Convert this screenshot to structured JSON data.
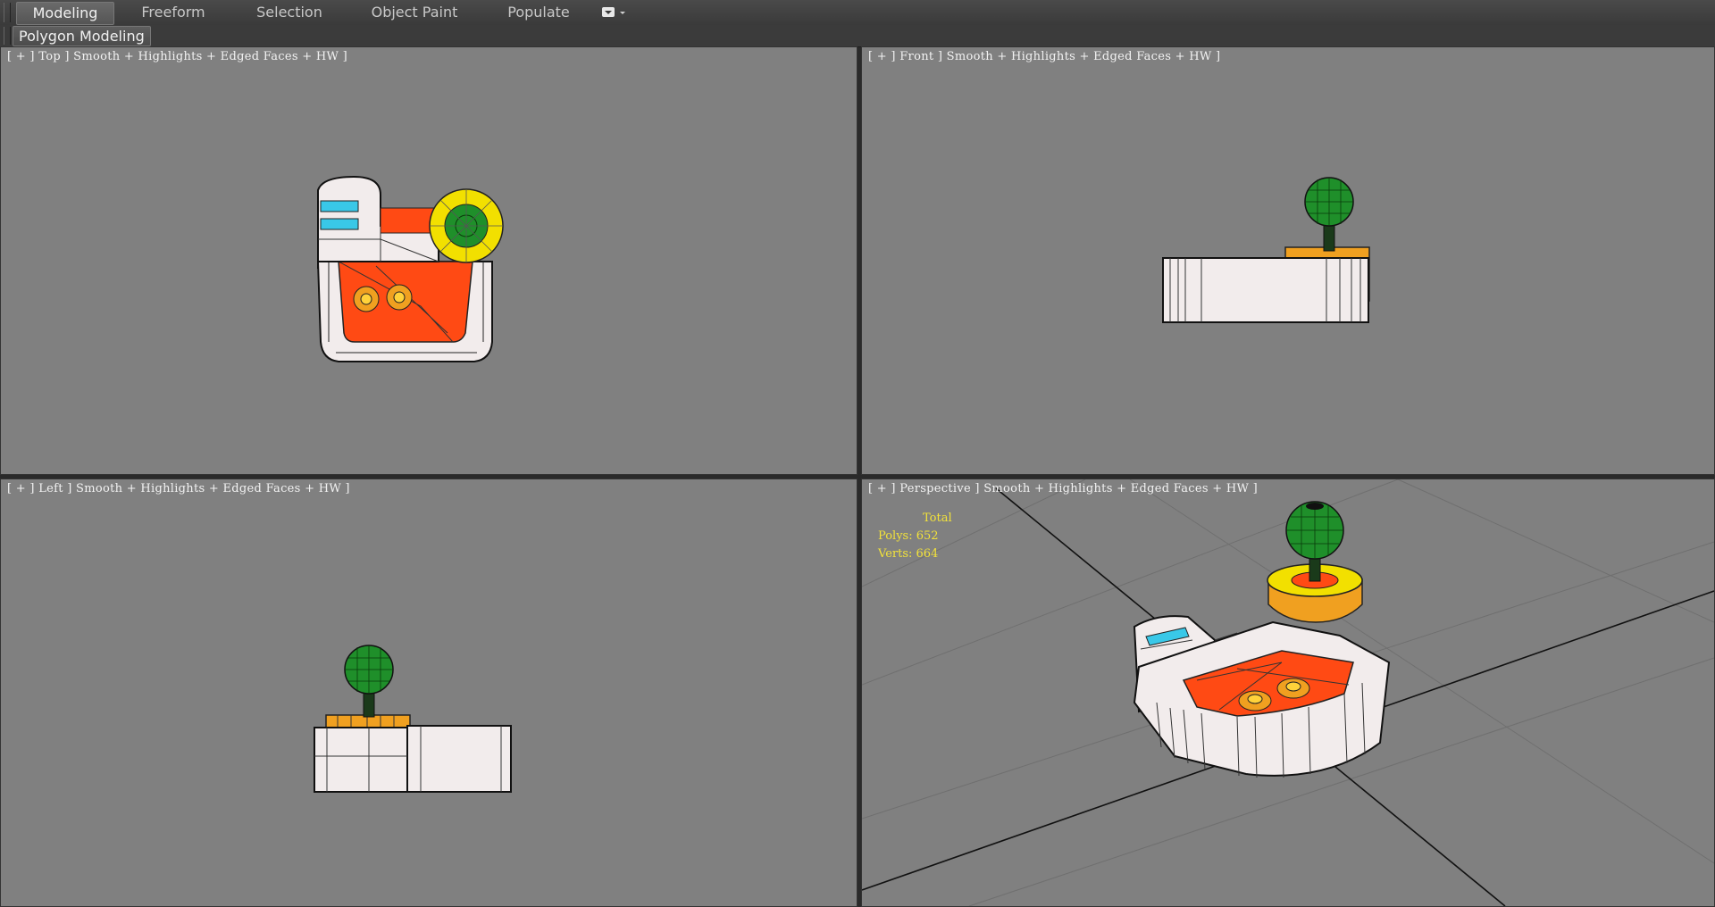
{
  "ribbon": {
    "tabs": [
      {
        "label": "Modeling",
        "active": true
      },
      {
        "label": "Freeform",
        "active": false
      },
      {
        "label": "Selection",
        "active": false
      },
      {
        "label": "Object Paint",
        "active": false
      },
      {
        "label": "Populate",
        "active": false
      }
    ],
    "more_icon": "dropdown-icon"
  },
  "subbar": {
    "label": "Polygon Modeling"
  },
  "viewports": {
    "top": {
      "label": "[ + ] Top ] Smooth + Highlights + Edged Faces + HW ]"
    },
    "front": {
      "label": "[ + ] Front ] Smooth + Highlights + Edged Faces + HW ]"
    },
    "left": {
      "label": "[ + ] Left ] Smooth + Highlights + Edged Faces + HW ]"
    },
    "perspective": {
      "label": "[ + ] Perspective ] Smooth + Highlights + Edged Faces + HW ]"
    }
  },
  "stats": {
    "title": "Total",
    "polys": "Polys: 652",
    "verts": "Verts: 664"
  },
  "colors": {
    "viewport_bg": "#808080",
    "body_white": "#f2ecec",
    "tray_orange": "#ff4a14",
    "knob_green": "#1f8f2a",
    "ring_yellow": "#f2e000",
    "accent_orange": "#f0a020",
    "screen_cyan": "#39c8e8",
    "stats_yellow": "#f2e23a"
  }
}
